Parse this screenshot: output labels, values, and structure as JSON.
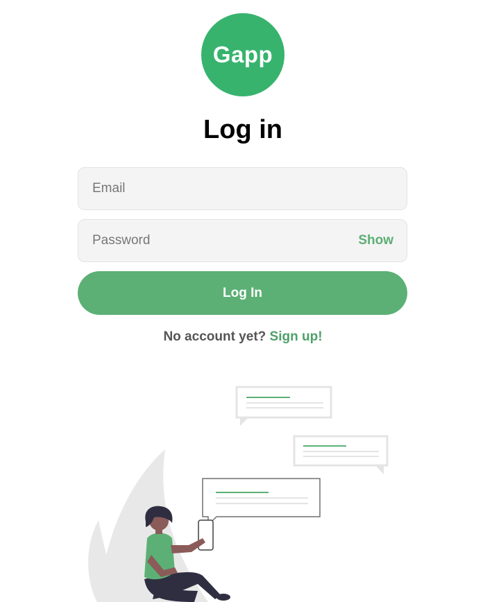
{
  "brand": {
    "logo_text": "Gapp",
    "color": "#37b36e"
  },
  "form": {
    "title": "Log in",
    "email": {
      "placeholder": "Email",
      "value": ""
    },
    "password": {
      "placeholder": "Password",
      "value": "",
      "toggle_label": "Show"
    },
    "submit_label": "Log In"
  },
  "signup": {
    "prompt": "No account yet?",
    "link_label": "Sign up!"
  },
  "colors": {
    "accent": "#5cb075",
    "link": "#4ea06a",
    "field_bg": "#f4f4f4"
  },
  "illustration": {
    "icon": "person-texting-chat-bubbles-illustration"
  }
}
